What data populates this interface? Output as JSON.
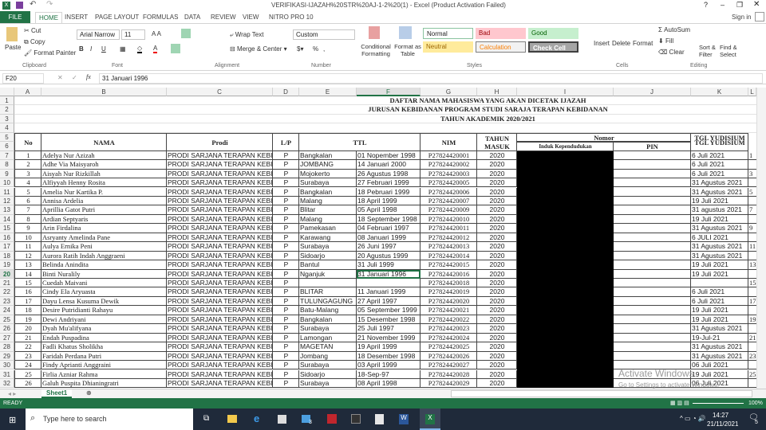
{
  "window": {
    "title": "VERIFIKASI-IJAZAH%20STR%20AJ-1-2%20(1) - Excel (Product Activation Failed)",
    "sign_in": "Sign in",
    "help": "?"
  },
  "tabs": [
    "FILE",
    "HOME",
    "INSERT",
    "PAGE LAYOUT",
    "FORMULAS",
    "DATA",
    "REVIEW",
    "VIEW",
    "NITRO PRO 10"
  ],
  "ribbon": {
    "clipboard": {
      "paste": "Paste",
      "cut": "Cut",
      "copy": "Copy",
      "format_painter": "Format Painter",
      "label": "Clipboard"
    },
    "font": {
      "name": "Arial Narrow",
      "size": "11",
      "bold": "B",
      "italic": "I",
      "underline": "U",
      "label": "Font"
    },
    "alignment": {
      "wrap": "Wrap Text",
      "merge": "Merge & Center",
      "label": "Alignment"
    },
    "number": {
      "format": "Custom",
      "percent": "%",
      "comma": ",",
      "label": "Number"
    },
    "styles": {
      "conditional": "Conditional Formatting",
      "format_table": "Format as Table",
      "normal": "Normal",
      "bad": "Bad",
      "good": "Good",
      "neutral": "Neutral",
      "calculation": "Calculation",
      "check_cell": "Check Cell",
      "label": "Styles"
    },
    "cells": {
      "insert": "Insert",
      "delete": "Delete",
      "format": "Format",
      "label": "Cells"
    },
    "editing": {
      "autosum": "AutoSum",
      "fill": "Fill",
      "clear": "Clear",
      "sort": "Sort & Filter",
      "find": "Find & Select",
      "label": "Editing"
    }
  },
  "formula_bar": {
    "cell_ref": "F20",
    "fx": "fx",
    "value": "31 Januari 1996"
  },
  "columns": [
    "A",
    "B",
    "C",
    "D",
    "E",
    "F",
    "G",
    "H",
    "I",
    "J",
    "K",
    "L"
  ],
  "sheet": {
    "title1": "DAFTAR NAMA MAHASISWA YANG AKAN DICETAK IJAZAH",
    "title2": "JURUSAN KEBIDANAN PROGRAM STUDI SARAJA TERAPAN KEBIDANAN",
    "title3": "TAHUN AKADEMIK 2020/2021",
    "headers": {
      "no": "No",
      "nama": "NAMA",
      "prodi": "Prodi",
      "lp": "L/P",
      "ttl": "TTL",
      "nim": "NIM",
      "tahun": "TAHUN MASUK",
      "nomor": "Nomor",
      "induk": "Induk Kependudukan",
      "pin": "PIN",
      "tgl": "TGL YUDISIUM"
    },
    "rows": [
      [
        "1",
        "Adelya Nur Azizah",
        "PRODI SARJANA TERAPAN KEBIDANAN",
        "P",
        "Bangkalan",
        "01 Nopember 1998",
        "P27824420001",
        "2020",
        "",
        "6 Juli 2021",
        "1"
      ],
      [
        "2",
        "Adhe Via Maisyaroh",
        "PRODI SARJANA TERAPAN KEBIDANAN",
        "P",
        "JOMBANG",
        "14 Januari 2000",
        "P27824420002",
        "2020",
        "",
        "6 Juli 2021",
        ""
      ],
      [
        "3",
        "Aisyah Nur Rizkillah",
        "PRODI SARJANA TERAPAN KEBIDANAN",
        "P",
        "Mojokerto",
        "26 Agustus 1998",
        "P27824420003",
        "2020",
        "",
        "6 Juli 2021",
        "3"
      ],
      [
        "4",
        "Alfiyyah Henny Rosita",
        "PRODI SARJANA TERAPAN KEBIDANAN",
        "P",
        "Surabaya",
        "27 Februari 1999",
        "P27824420005",
        "2020",
        "",
        "31 Agustus 2021",
        ""
      ],
      [
        "5",
        "Amelia Nur Kartika P.",
        "PRODI SARJANA TERAPAN KEBIDANAN",
        "P",
        "Bangkalan",
        "18 Pebruari 1999",
        "P27824420006",
        "2020",
        "",
        "31 Agustus 2021",
        "5"
      ],
      [
        "6",
        "Annisa Ardelia",
        "PRODI SARJANA TERAPAN KEBIDANAN",
        "P",
        "Malang",
        "18 April 1999",
        "P27824420007",
        "2020",
        "",
        "19 Juli 2021",
        ""
      ],
      [
        "7",
        "Aprillia Gatot Putri",
        "PRODI SARJANA TERAPAN KEBIDANAN",
        "P",
        "Blitar",
        "05 April 1998",
        "P27824420009",
        "2020",
        "",
        "31 agustus 2021",
        "7"
      ],
      [
        "8",
        "Ardian Septyaris",
        "PRODI SARJANA TERAPAN KEBIDANAN",
        "P",
        "Malang",
        "18 September 1998",
        "P27824420010",
        "2020",
        "",
        "19 Juli 2021",
        ""
      ],
      [
        "9",
        "Arin Firdalina",
        "PRODI SARJANA TERAPAN KEBIDANAN",
        "P",
        "Pamekasan",
        "04 Februari 1997",
        "P27824420011",
        "2020",
        "",
        "31 Agustus 2021",
        "9"
      ],
      [
        "10",
        "Asryanty Amelinda Pane",
        "PRODI SARJANA TERAPAN KEBIDANAN",
        "P",
        "Karawang",
        "08 Januari 1999",
        "P27824420012",
        "2020",
        "",
        "6 JULI 2021",
        ""
      ],
      [
        "11",
        "Aulya Ernika Peni",
        "PRODI SARJANA TERAPAN KEBIDANAN",
        "P",
        "Surabaya",
        "26 Juni 1997",
        "P27824420013",
        "2020",
        "",
        "31 Agustus 2021",
        "11"
      ],
      [
        "12",
        "Aurora Ratih Indah Anggraeni",
        "PRODI SARJANA TERAPAN KEBIDANAN",
        "P",
        "Sidoarjo",
        "20 Agustus 1999",
        "P27824420014",
        "2020",
        "",
        "31 Agustus 2021",
        ""
      ],
      [
        "13",
        "Belinda Anindita",
        "PRODI SARJANA TERAPAN KEBIDANAN",
        "P",
        "Bantul",
        "31 Juli 1999",
        "P27824420015",
        "2020",
        "",
        "19 Juli 2021",
        "13"
      ],
      [
        "14",
        "Binti Nuralily",
        "PRODI SARJANA TERAPAN KEBIDANAN",
        "P",
        "Nganjuk",
        "31 Januari 1996",
        "P27824420016",
        "2020",
        "",
        "19 Juli 2021",
        ""
      ],
      [
        "15",
        "Cuedah Maivani",
        "PRODI SARJANA TERAPAN KEBIDANAN",
        "P",
        "",
        "",
        "P27824420018",
        "2020",
        "",
        "",
        "15"
      ],
      [
        "16",
        "Cindy Ela Aryuasta",
        "PRODI SARJANA TERAPAN KEBIDANAN",
        "P",
        "BLITAR",
        "11 Januari 1999",
        "P27824420019",
        "2020",
        "",
        "6 Juli 2021",
        ""
      ],
      [
        "17",
        "Dayu Lensa Kusuma Dewik",
        "PRODI SARJANA TERAPAN KEBIDANAN",
        "P",
        "TULUNGAGUNG",
        "27 April 1997",
        "P27824420020",
        "2020",
        "",
        "6 Juli 2021",
        "17"
      ],
      [
        "18",
        "Desire Putridianti Rahayu",
        "PRODI SARJANA TERAPAN KEBIDANAN",
        "P",
        "Batu-Malang",
        "05 September 1999",
        "P27824420021",
        "2020",
        "",
        "19 Juli 2021",
        ""
      ],
      [
        "19",
        "Dewi Andriyani",
        "PRODI SARJANA TERAPAN KEBIDANAN",
        "P",
        "Bangkalan",
        "15 Desember 1998",
        "P27824420022",
        "2020",
        "",
        "19 Juli 2021",
        "19"
      ],
      [
        "20",
        "Dyah Mu'alifyana",
        "PRODI SARJANA TERAPAN KEBIDANAN",
        "P",
        "Surabaya",
        "25 Juli 1997",
        "P27824420023",
        "2020",
        "",
        "31 Agustus 2021",
        ""
      ],
      [
        "21",
        "Endah Puspadina",
        "PRODI SARJANA TERAPAN KEBIDANAN",
        "P",
        "Lamongan",
        "21 November 1999",
        "P27824420024",
        "2020",
        "",
        "19-Jul-21",
        "21"
      ],
      [
        "22",
        "Fadli Khatus Sholikha",
        "PRODI SARJANA TERAPAN KEBIDANAN",
        "P",
        "MAGETAN",
        "19 April 1999",
        "P27824420025",
        "2020",
        "",
        "31 Agustus 2021",
        ""
      ],
      [
        "23",
        "Faridah Perdana Putri",
        "PRODI SARJANA TERAPAN KEBIDANAN",
        "P",
        "Jombang",
        "18 Desember 1998",
        "P27824420026",
        "2020",
        "",
        "31 Agustus 2021",
        "23"
      ],
      [
        "24",
        "Findy Aprianti Anggraini",
        "PRODI SARJANA TERAPAN KEBIDANAN",
        "P",
        "Surabaya",
        "03 April 1999",
        "P27824420027",
        "2020",
        "",
        "06 Juli 2021",
        ""
      ],
      [
        "25",
        "Firlia Azniar Rahma",
        "PRODI SARJANA TERAPAN KEBIDANAN",
        "P",
        "Sidoarjo",
        "18-Sep-97",
        "P27824420028",
        "2020",
        "",
        "19 Juli 2021",
        "25"
      ],
      [
        "26",
        "Galuh Puspita Dhianingratri",
        "PRODI SARJANA TERAPAN KEBIDANAN",
        "P",
        "Surabaya",
        "08 April 1998",
        "P27824420029",
        "2020",
        "",
        "06 Juli 2021",
        ""
      ]
    ]
  },
  "watermark": {
    "line1": "Activate Windows",
    "line2": "Go to Settings to activate Windows."
  },
  "sheet_tab": "Sheet1",
  "status": {
    "text": "READY",
    "zoom": "100%"
  },
  "taskbar": {
    "search_placeholder": "Type here to search",
    "time": "14:27",
    "date": "21/11/2021",
    "mail_badge": "3",
    "notif_badge": "5"
  },
  "colors": {
    "excel_green": "#217346",
    "redaction": "#000000"
  }
}
